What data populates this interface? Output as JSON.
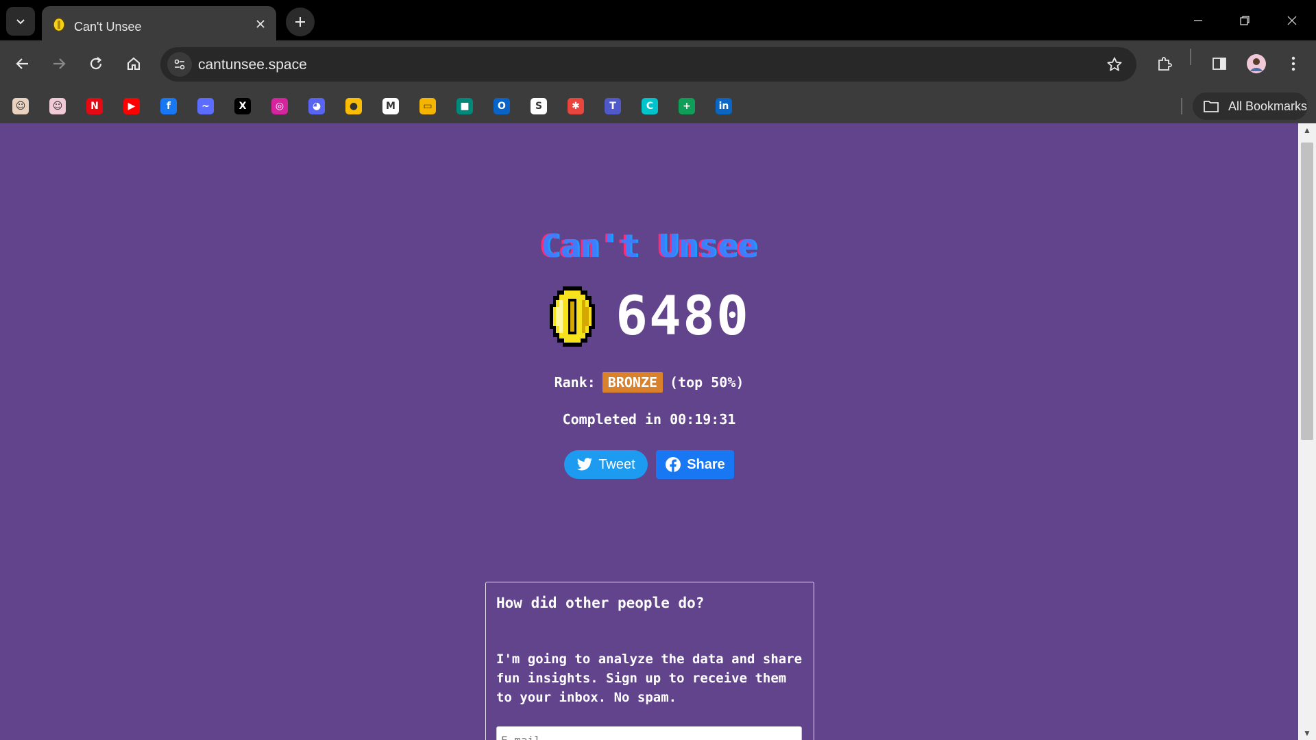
{
  "browser": {
    "tab_title": "Can't Unsee",
    "url": "cantunsee.space",
    "all_bookmarks_label": "All Bookmarks",
    "bookmarks": [
      {
        "name": "avatar-1",
        "color": "#e9d2c0",
        "glyph": "☺"
      },
      {
        "name": "avatar-2",
        "color": "#f2c9d6",
        "glyph": "☺"
      },
      {
        "name": "netflix",
        "color": "#e50914",
        "glyph": "N"
      },
      {
        "name": "youtube",
        "color": "#ff0000",
        "glyph": "▶"
      },
      {
        "name": "facebook",
        "color": "#1877f2",
        "glyph": "f"
      },
      {
        "name": "messenger",
        "color": "#5b6cff",
        "glyph": "~"
      },
      {
        "name": "x",
        "color": "#000000",
        "glyph": "X"
      },
      {
        "name": "instagram",
        "color": "#d6249f",
        "glyph": "◎"
      },
      {
        "name": "discord",
        "color": "#5865f2",
        "glyph": "◕"
      },
      {
        "name": "keep",
        "color": "#fbbc04",
        "glyph": "●"
      },
      {
        "name": "gmail",
        "color": "#ffffff",
        "glyph": "M"
      },
      {
        "name": "slides",
        "color": "#f4b400",
        "glyph": "▭"
      },
      {
        "name": "meet",
        "color": "#00897b",
        "glyph": "■"
      },
      {
        "name": "outlook",
        "color": "#0a64c8",
        "glyph": "O"
      },
      {
        "name": "skype",
        "color": "#ffffff",
        "glyph": "S"
      },
      {
        "name": "app-red",
        "color": "#e8453c",
        "glyph": "✱"
      },
      {
        "name": "teams",
        "color": "#5059c9",
        "glyph": "T"
      },
      {
        "name": "canva",
        "color": "#00c4cc",
        "glyph": "C"
      },
      {
        "name": "sheets",
        "color": "#0f9d58",
        "glyph": "+"
      },
      {
        "name": "linkedin",
        "color": "#0a66c2",
        "glyph": "in"
      }
    ]
  },
  "page": {
    "title": "Can't Unsee",
    "score": "6480",
    "rank_label": "Rank:",
    "rank_badge": "BRONZE",
    "rank_note": "(top 50%)",
    "completed": "Completed in 00:19:31",
    "tweet_label": "Tweet",
    "share_label": "Share",
    "card": {
      "question": "How did other people do?",
      "description": "I'm going to analyze the data and share fun insights. Sign up to receive them to your inbox. No spam.",
      "email_placeholder": "E-mail"
    }
  },
  "colors": {
    "page_background": "#62448c",
    "rank_badge": "#d9812b",
    "tweet": "#1d9bf0",
    "facebook": "#1877f2"
  }
}
